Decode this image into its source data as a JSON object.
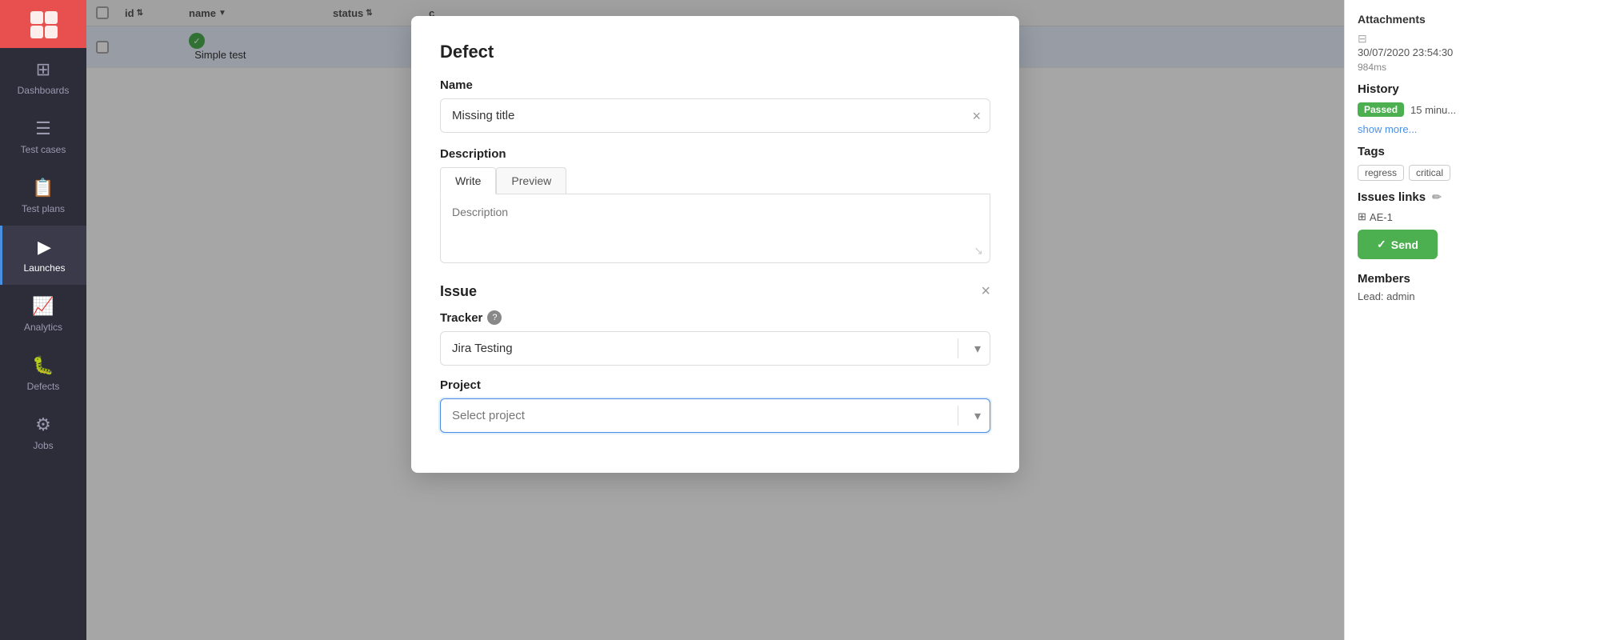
{
  "sidebar": {
    "logo_bg": "#e85050",
    "items": [
      {
        "id": "dashboards",
        "label": "Dashboards",
        "icon": "⊞",
        "active": false
      },
      {
        "id": "test-cases",
        "label": "Test cases",
        "icon": "☰",
        "active": false
      },
      {
        "id": "test-plans",
        "label": "Test plans",
        "icon": "📋",
        "active": false
      },
      {
        "id": "launches",
        "label": "Launches",
        "icon": "▶",
        "active": true
      },
      {
        "id": "analytics",
        "label": "Analytics",
        "icon": "📈",
        "active": false
      },
      {
        "id": "defects",
        "label": "Defects",
        "icon": "🐛",
        "active": false
      },
      {
        "id": "jobs",
        "label": "Jobs",
        "icon": "⚙",
        "active": false
      }
    ]
  },
  "table": {
    "columns": [
      "",
      "id",
      "name",
      "status",
      "c"
    ],
    "row": {
      "id": "",
      "name": "Simple test",
      "status": "passed"
    }
  },
  "right_panel": {
    "attachments_label": "Attachments",
    "timestamp": "30/07/2020 23:54:30",
    "duration": "984ms",
    "history_label": "History",
    "history_entry": {
      "badge": "Passed",
      "time": "15 minu..."
    },
    "show_more": "show more...",
    "tags_label": "Tags",
    "tags": [
      "regress",
      "critical"
    ],
    "issues_links_label": "Issues links",
    "issue_link": "AE-1",
    "send_btn_label": "Send",
    "members_label": "Members",
    "lead_label": "Lead:",
    "lead_value": "admin"
  },
  "modal": {
    "title": "Defect",
    "name_label": "Name",
    "name_value": "Missing title",
    "name_clear_aria": "clear name",
    "description_label": "Description",
    "desc_tab_write": "Write",
    "desc_tab_preview": "Preview",
    "desc_placeholder": "Description",
    "issue_title": "Issue",
    "issue_close_aria": "close issue",
    "tracker_label": "Tracker",
    "tracker_value": "Jira Testing",
    "project_label": "Project",
    "project_placeholder": "Select project"
  }
}
